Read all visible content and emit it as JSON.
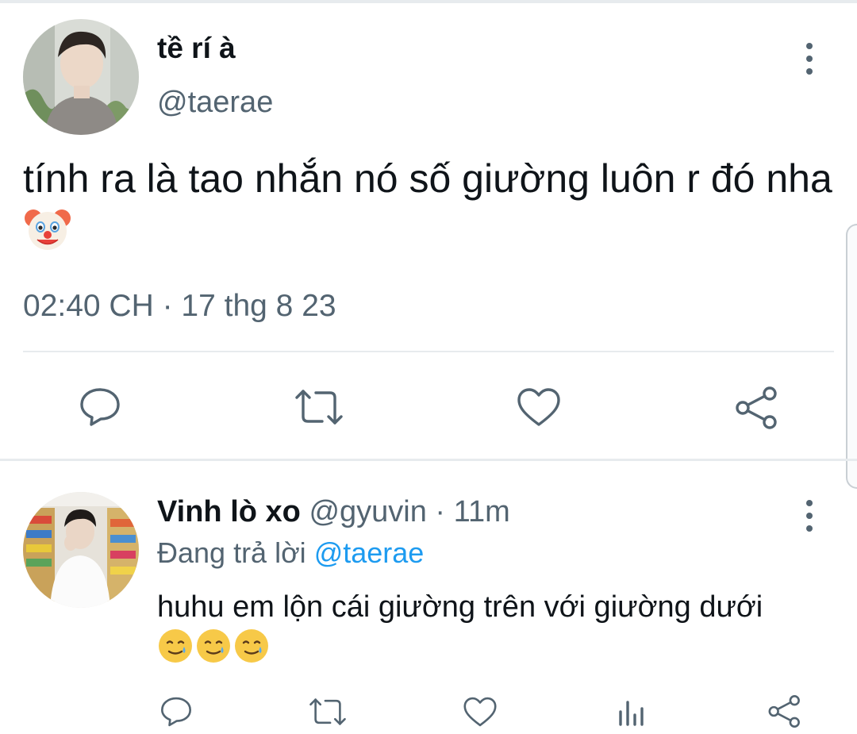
{
  "main_tweet": {
    "display_name": "tề rí à",
    "handle": "@taerae",
    "text": "tính ra là tao nhắn nó số giường luôn r đó nha",
    "emoji": "clown-face",
    "timestamp": "02:40 CH · 17 thg 8 23",
    "actions": [
      "reply-icon",
      "retweet-icon",
      "like-icon",
      "share-icon"
    ]
  },
  "reply": {
    "display_name": "Vinh lò xo",
    "handle": "@gyuvin",
    "separator": "·",
    "time": "11m",
    "replying_prefix": "Đang trả lời",
    "replying_to": "@taerae",
    "text": "huhu em lộn cái giường trên với giường dưới",
    "emojis": [
      "smiling-face-with-tear",
      "smiling-face-with-tear",
      "smiling-face-with-tear"
    ],
    "actions": [
      "reply-icon",
      "retweet-icon",
      "like-icon",
      "views-icon",
      "share-icon"
    ]
  },
  "colors": {
    "text": "#0f1419",
    "muted": "#536471",
    "link": "#1d9bf0",
    "divider": "#e7ebee"
  }
}
